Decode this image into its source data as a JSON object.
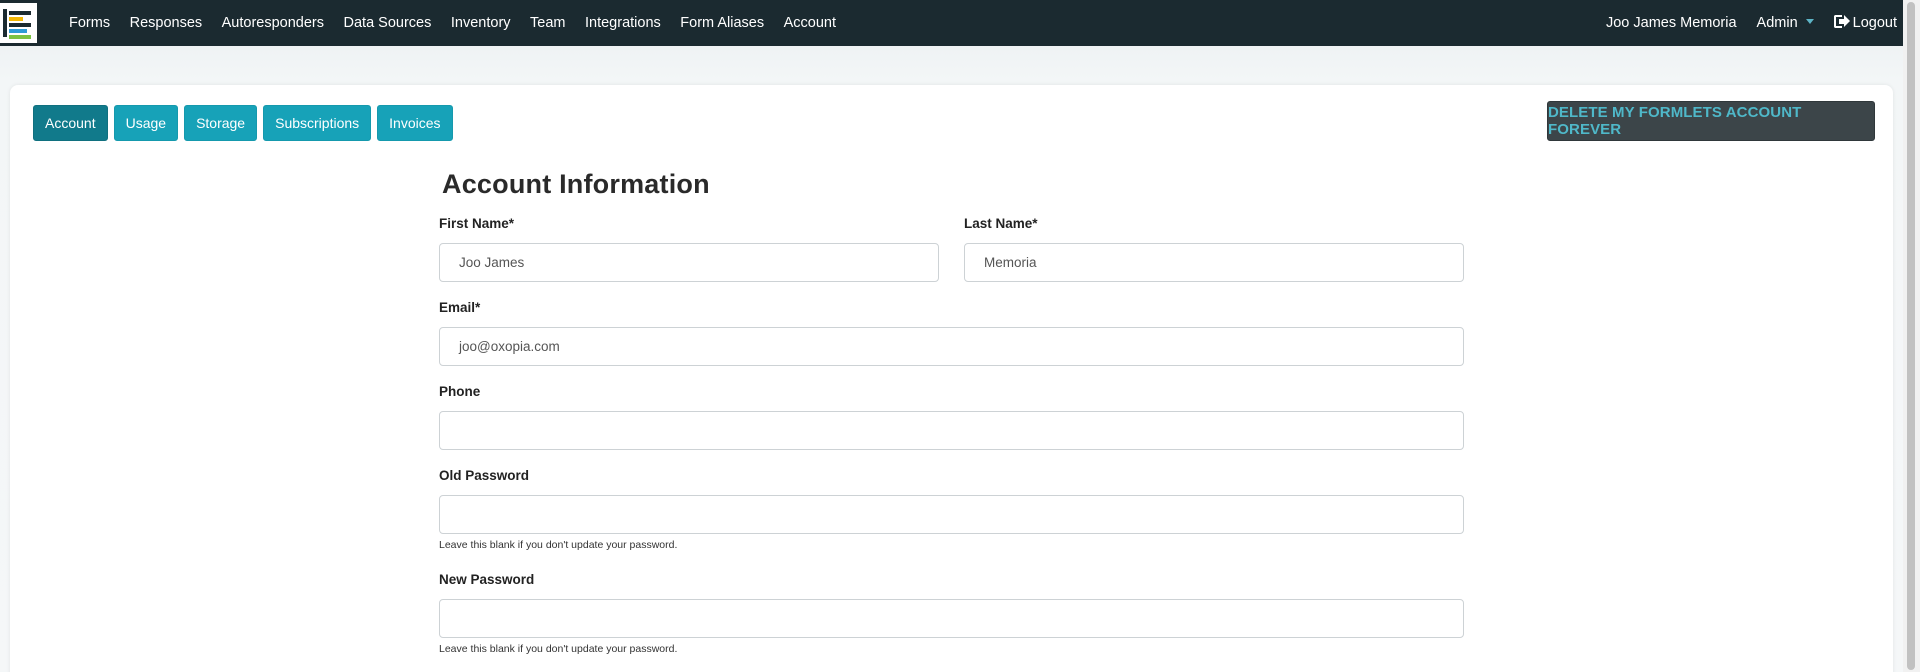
{
  "nav": {
    "items": [
      "Forms",
      "Responses",
      "Autoresponders",
      "Data Sources",
      "Inventory",
      "Team",
      "Integrations",
      "Form Aliases",
      "Account"
    ],
    "user_name": "Joo James Memoria",
    "admin_label": "Admin",
    "logout_label": "Logout"
  },
  "tabs": [
    "Account",
    "Usage",
    "Storage",
    "Subscriptions",
    "Invoices"
  ],
  "active_tab": "Account",
  "delete_button_label": "DELETE MY FORMLETS ACCOUNT FOREVER",
  "form": {
    "title": "Account Information",
    "first_name": {
      "label": "First Name*",
      "value": "Joo James"
    },
    "last_name": {
      "label": "Last Name*",
      "value": "Memoria"
    },
    "email": {
      "label": "Email*",
      "value": "joo@oxopia.com"
    },
    "phone": {
      "label": "Phone",
      "value": ""
    },
    "old_password": {
      "label": "Old Password",
      "value": "",
      "hint": "Leave this blank if you don't update your password."
    },
    "new_password": {
      "label": "New Password",
      "value": "",
      "hint": "Leave this blank if you don't update your password."
    }
  },
  "colors": {
    "navbar": "#1b2a30",
    "tab": "#17a2b8",
    "tab_active": "#117a8b",
    "danger_button": "#3c4549",
    "danger_text": "#4fb8c9"
  }
}
